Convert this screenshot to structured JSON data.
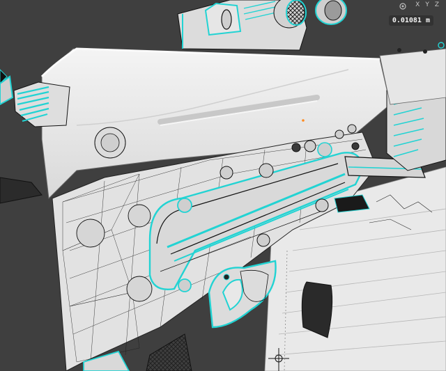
{
  "viewport": {
    "axis_labels": [
      "X",
      "Y",
      "Z"
    ],
    "measurement": "0.01081 m"
  },
  "colors": {
    "background": "#3f3f3f",
    "mesh": "#e4e4e4",
    "wire": "#1a1a1a",
    "selected_edges": "#22d3d3",
    "origin_marker": "#ff8a1f"
  },
  "icons": [
    "move-gizmo-icon",
    "snap-icon",
    "3d-cursor-icon"
  ]
}
